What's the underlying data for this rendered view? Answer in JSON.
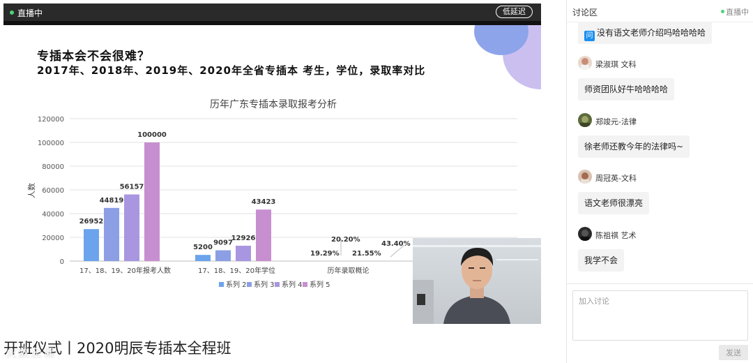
{
  "live": {
    "status": "直播中",
    "low_latency_label": "低延迟"
  },
  "slide": {
    "title_line1": "专插本会不会很难？",
    "title_line2": "2017年、2018年、2019年、2020年全省专插本 考生，学位，录取率对比"
  },
  "chart_data": {
    "type": "bar",
    "title": "历年广东专插本录取报考分析",
    "ylabel": "人数",
    "xlabel": "",
    "ylim": [
      0,
      120000
    ],
    "yticks": [
      "0",
      "20000",
      "40000",
      "60000",
      "80000",
      "100000",
      "120000"
    ],
    "categories": [
      "17、18、19、20年报考人数",
      "17、18、19、20年学位",
      "历年录取概论"
    ],
    "legend_position": "bottom",
    "grid": true,
    "series": [
      {
        "name": "系列 2",
        "color": "#6ba4ec",
        "values": [
          26952,
          5200,
          null
        ],
        "labels": [
          "26952",
          "5200",
          "19.29%"
        ]
      },
      {
        "name": "系列 3",
        "color": "#8c9fe4",
        "values": [
          44819,
          9097,
          null
        ],
        "labels": [
          "44819",
          "9097",
          "20.20%"
        ]
      },
      {
        "name": "系列 4",
        "color": "#a996e0",
        "values": [
          56157,
          12926,
          null
        ],
        "labels": [
          "56157",
          "12926",
          "21.55%"
        ]
      },
      {
        "name": "系列 5",
        "color": "#c78fd0",
        "values": [
          100000,
          43423,
          null
        ],
        "labels": [
          "100000",
          "43423",
          "43.40%"
        ]
      }
    ]
  },
  "course_title": "开班仪式丨2020明辰专插本全程班",
  "watermark": "火数云课",
  "discussion": {
    "title": "讨论区",
    "live_status": "直播中",
    "messages": [
      {
        "type": "question",
        "icon_label": "问",
        "text": "没有语文老师介绍吗哈哈哈哈"
      },
      {
        "user": "梁淑琪 文科",
        "text": "师资团队好牛哈哈哈哈"
      },
      {
        "user": "郑竣元-法律",
        "text": "徐老师还教今年的法律吗~"
      },
      {
        "user": "周冠英-文科",
        "text": "语文老师很漂亮"
      },
      {
        "user": "陈祖祺 艺术",
        "text": "我学不会"
      }
    ],
    "input_placeholder": "加入讨论",
    "send_label": "发送"
  }
}
